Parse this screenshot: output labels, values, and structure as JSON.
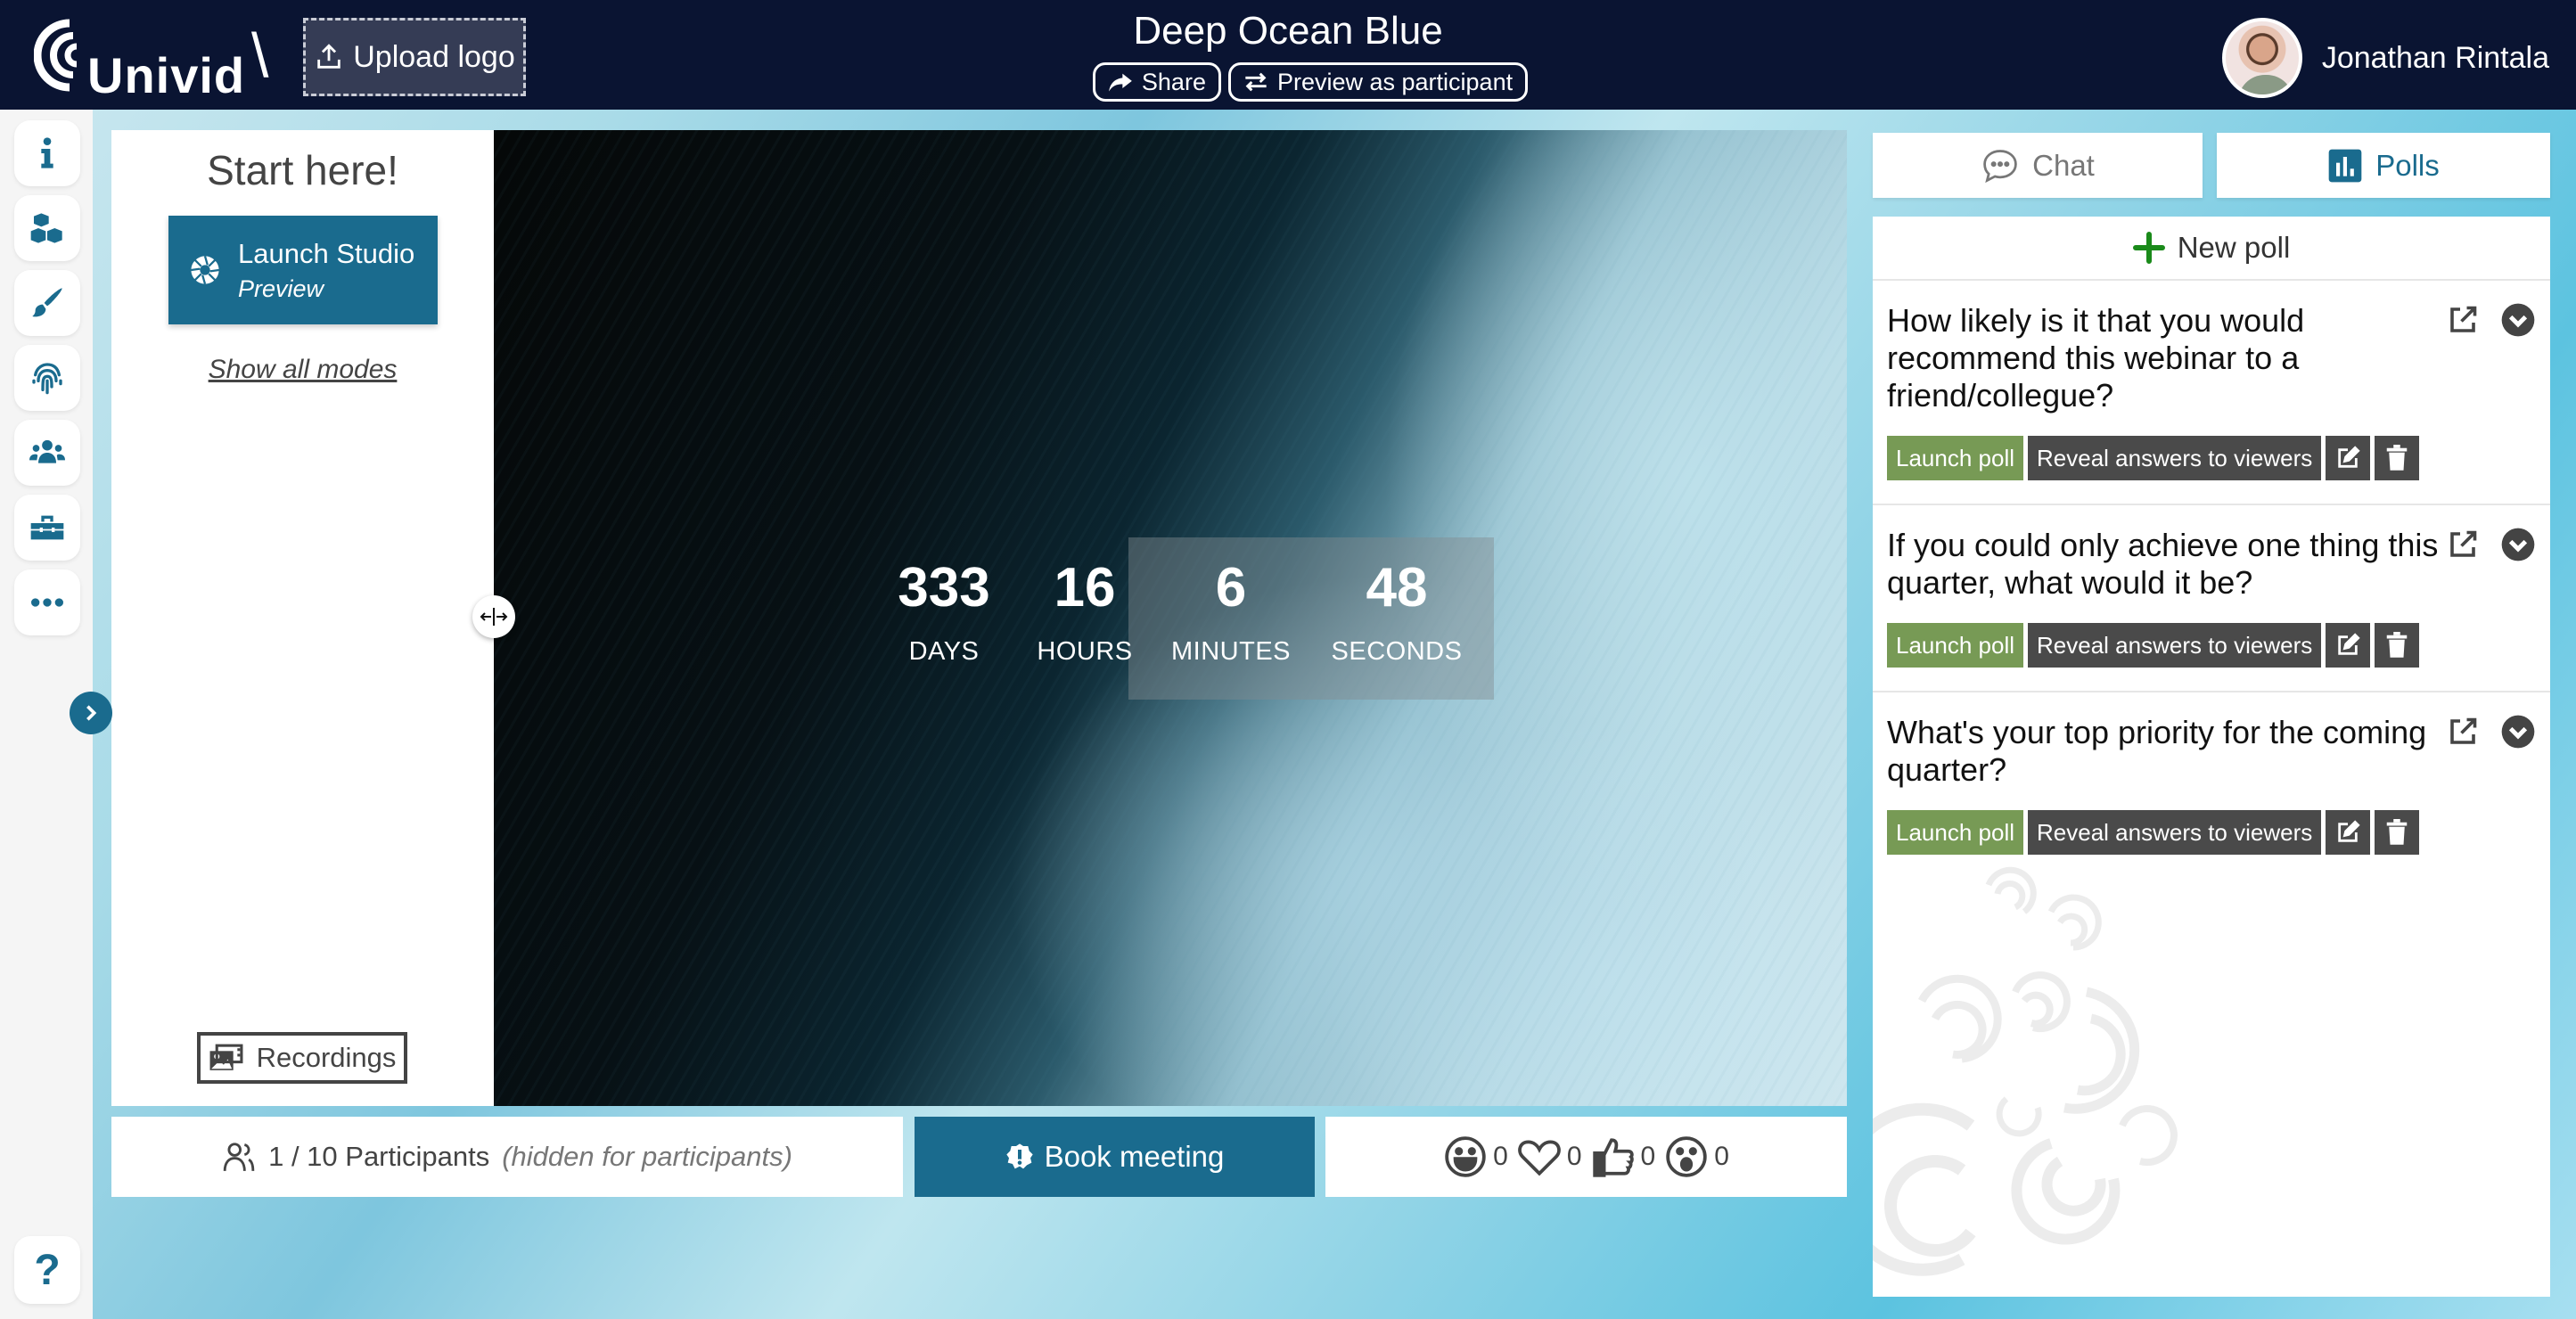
{
  "header": {
    "logo_text": "Univid",
    "separator": "\\",
    "upload_logo_label": "Upload logo",
    "title": "Deep Ocean Blue",
    "share_label": "Share",
    "preview_label": "Preview as participant",
    "user_name": "Jonathan Rintala"
  },
  "sidebar": {
    "items": [
      {
        "icon": "info-icon"
      },
      {
        "icon": "cubes-icon"
      },
      {
        "icon": "paint-brush-icon"
      },
      {
        "icon": "fingerprint-icon"
      },
      {
        "icon": "users-icon"
      },
      {
        "icon": "toolbox-icon"
      },
      {
        "icon": "more-icon"
      }
    ],
    "help_label": "?"
  },
  "start_panel": {
    "title": "Start here!",
    "launch_label": "Launch Studio",
    "launch_mode": "Preview",
    "show_modes_label": "Show all modes",
    "recordings_label": "Recordings"
  },
  "countdown": {
    "days": "333",
    "days_label": "DAYS",
    "hours": "16",
    "hours_label": "HOURS",
    "minutes": "6",
    "minutes_label": "MINUTES",
    "seconds": "48",
    "seconds_label": "SECONDS"
  },
  "bottom": {
    "participants_count": "1 / 10 Participants",
    "participants_hint": "(hidden for participants)",
    "book_meeting_label": "Book meeting",
    "reactions": [
      {
        "icon": "laugh-icon",
        "count": "0"
      },
      {
        "icon": "heart-icon",
        "count": "0"
      },
      {
        "icon": "thumbs-up-icon",
        "count": "0"
      },
      {
        "icon": "surprised-icon",
        "count": "0"
      }
    ]
  },
  "right_panel": {
    "tabs": [
      {
        "label": "Chat",
        "active": false
      },
      {
        "label": "Polls",
        "active": true
      }
    ],
    "new_poll_label": "New poll",
    "polls": [
      {
        "question": "How likely is it that you would recommend this webinar to a friend/collegue?",
        "launch_label": "Launch poll",
        "reveal_label": "Reveal answers to viewers"
      },
      {
        "question": "If you could only achieve one thing this quarter, what would it be?",
        "launch_label": "Launch poll",
        "reveal_label": "Reveal answers to viewers"
      },
      {
        "question": "What's your top priority for the coming quarter?",
        "launch_label": "Launch poll",
        "reveal_label": "Reveal answers to viewers"
      }
    ]
  },
  "colors": {
    "header_bg": "#0a1432",
    "accent": "#1a6b8e",
    "launch_poll": "#779a55",
    "dark_button": "#4a4a4a",
    "new_poll_plus": "#1a8a1a"
  }
}
